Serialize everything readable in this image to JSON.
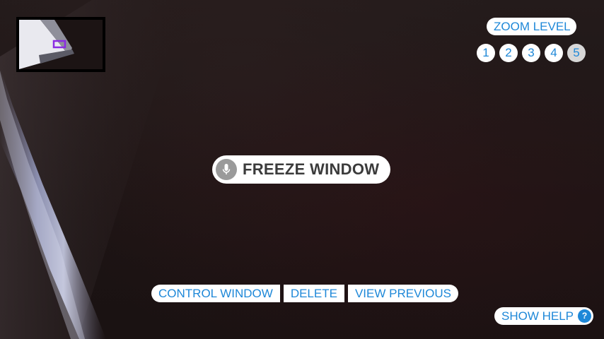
{
  "zoom": {
    "label": "ZOOM LEVEL",
    "levels": [
      "1",
      "2",
      "3",
      "4",
      "5"
    ],
    "selected": "5"
  },
  "freeze": {
    "label": "FREEZE WINDOW",
    "icon": "microphone-icon"
  },
  "toolbar": {
    "control_window": "CONTROL WINDOW",
    "delete": "DELETE",
    "view_previous": "VIEW PREVIOUS"
  },
  "help": {
    "label": "SHOW HELP",
    "icon_glyph": "?"
  },
  "colors": {
    "accent": "#1e88d8",
    "minimap_marker": "#8a2be2",
    "active_zoom": "#d7d7d7"
  }
}
